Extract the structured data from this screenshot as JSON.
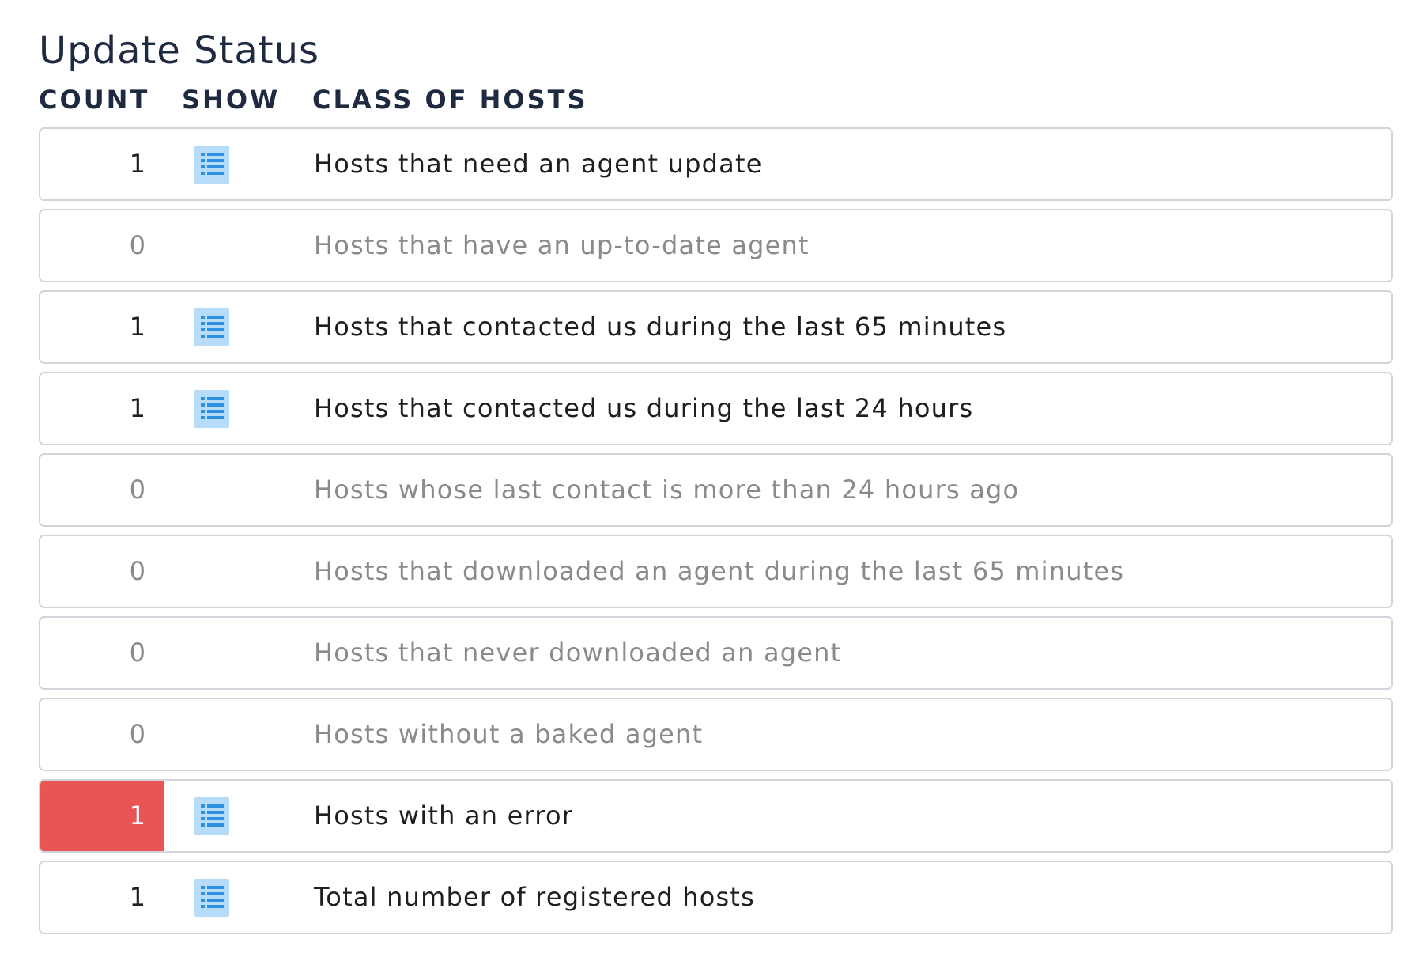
{
  "page": {
    "title": "Update Status"
  },
  "columns": {
    "count": "COUNT",
    "show": "SHOW",
    "class_of_hosts": "CLASS OF HOSTS"
  },
  "colors": {
    "error": "#e85554",
    "icon_bg": "#b6dcfa",
    "icon_fg": "#2f8fe0",
    "active_text": "#1e1e1e",
    "inactive_text": "#8a8a8a"
  },
  "icons": {
    "show_icon": "list-icon"
  },
  "rows": [
    {
      "count": "1",
      "label": "Hosts that need an agent update",
      "show": true,
      "state": "active"
    },
    {
      "count": "0",
      "label": "Hosts that have an up-to-date agent",
      "show": false,
      "state": "inactive"
    },
    {
      "count": "1",
      "label": "Hosts that contacted us during the last 65 minutes",
      "show": true,
      "state": "active"
    },
    {
      "count": "1",
      "label": "Hosts that contacted us during the last 24 hours",
      "show": true,
      "state": "active"
    },
    {
      "count": "0",
      "label": "Hosts whose last contact is more than 24 hours ago",
      "show": false,
      "state": "inactive"
    },
    {
      "count": "0",
      "label": "Hosts that downloaded an agent during the last 65 minutes",
      "show": false,
      "state": "inactive"
    },
    {
      "count": "0",
      "label": "Hosts that never downloaded an agent",
      "show": false,
      "state": "inactive"
    },
    {
      "count": "0",
      "label": "Hosts without a baked agent",
      "show": false,
      "state": "inactive"
    },
    {
      "count": "1",
      "label": "Hosts with an error",
      "show": true,
      "state": "error"
    },
    {
      "count": "1",
      "label": "Total number of registered hosts",
      "show": true,
      "state": "active"
    }
  ]
}
